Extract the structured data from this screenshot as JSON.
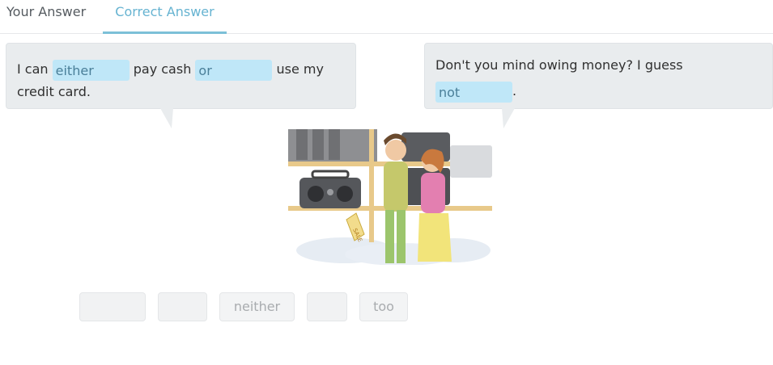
{
  "tabs": [
    {
      "label": "Your Answer"
    },
    {
      "label": "Correct Answer"
    }
  ],
  "left_bubble": {
    "part1": "I can",
    "blank1": "either",
    "part2": "pay cash",
    "blank2": "or",
    "part3": "use my credit card."
  },
  "right_bubble": {
    "part1": "Don't you mind owing money? I guess",
    "blank1": "not",
    "part2": "."
  },
  "word_bank": [
    {
      "label": ""
    },
    {
      "label": ""
    },
    {
      "label": "neither"
    },
    {
      "label": ""
    },
    {
      "label": "too"
    }
  ],
  "illustration": {
    "sign_text": "SALE"
  },
  "colors": {
    "active_tab": "#66b3d1",
    "blank_bg": "#bfe7f8",
    "bubble_bg": "#e9ecee"
  }
}
